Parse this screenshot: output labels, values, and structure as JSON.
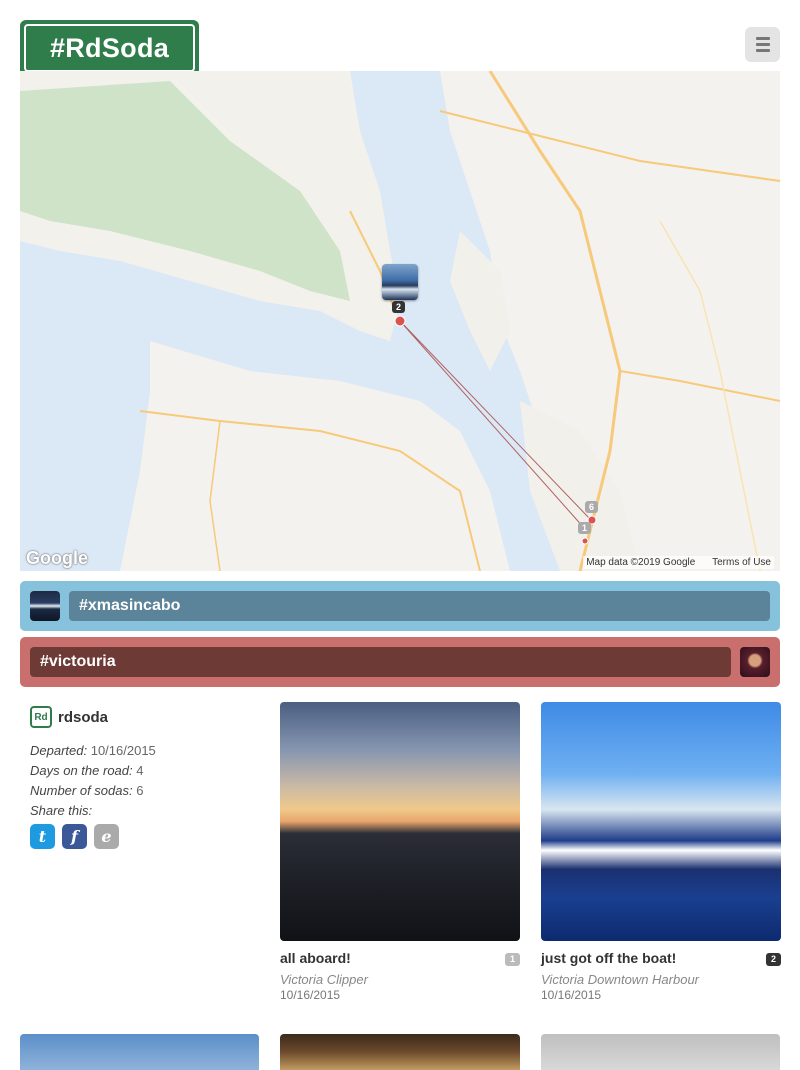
{
  "header": {
    "logo_text": "#RdSoda",
    "menu_icon": "hamburger-icon"
  },
  "map": {
    "google_logo": "Google",
    "attribution": "Map data ©2019 Google",
    "terms": "Terms of Use",
    "markers": [
      {
        "label": "2"
      },
      {
        "label": "6"
      },
      {
        "label": "1"
      }
    ]
  },
  "hashtags": [
    {
      "tag": "#xmasincabo",
      "color": "#86c2dc"
    },
    {
      "tag": "#victouria",
      "color": "#c9706e"
    }
  ],
  "info": {
    "user_badge": "Rd",
    "username": "rdsoda",
    "departed_label": "Departed:",
    "departed_value": "10/16/2015",
    "days_label": "Days on the road:",
    "days_value": "4",
    "sodas_label": "Number of sodas:",
    "sodas_value": "6",
    "share_label": "Share this:",
    "share": [
      {
        "letter": "t",
        "icon": "twitter-icon"
      },
      {
        "letter": "f",
        "icon": "facebook-icon"
      },
      {
        "letter": "e",
        "icon": "email-icon"
      }
    ]
  },
  "posts": [
    {
      "title": "all aboard!",
      "count": "1",
      "location": "Victoria Clipper",
      "date": "10/16/2015"
    },
    {
      "title": "just got off the boat!",
      "count": "2",
      "location": "Victoria Downtown Harbour",
      "date": "10/16/2015"
    }
  ],
  "colors": {
    "brand_green": "#2e7d4a",
    "blue_bar": "#86c2dc",
    "red_bar": "#c9706e"
  }
}
